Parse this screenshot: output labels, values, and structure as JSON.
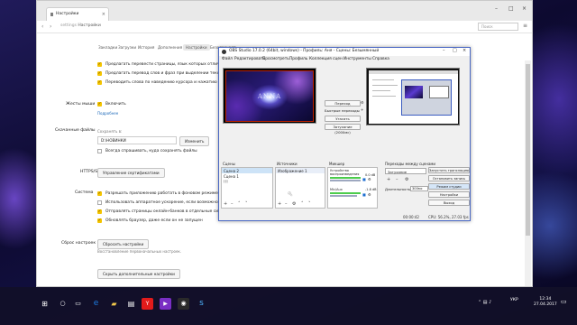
{
  "browser": {
    "tab_title": "Настройки",
    "url_prefix": "≡",
    "url_text": "settings",
    "url_title": "Настройки",
    "search_placeholder": "Поиск",
    "bookmarks": [
      "Закладки",
      "Загрузки",
      "История",
      "Дополнения",
      "Настройки",
      "Безопасность"
    ],
    "active_bookmark": 4
  },
  "settings": {
    "rows_top": [
      "Предлагать перевести страницы, язык которых отличается от языка интерфейса",
      "Предлагать перевод слов и фраз при выделении текста",
      "Переводить слова по наведению курсора и нажатию клавиши Shift"
    ],
    "gestures_section": "Жесты мыши",
    "gestures_enable": "Включить",
    "gestures_link": "Подробнее",
    "downloads_section": "Скачанные файлы",
    "save_to_label": "Сохранять в:",
    "save_path": "D:\\НОВИНКИ",
    "change_button": "Изменить",
    "always_ask": "Всегда спрашивать, куда сохранять файлы",
    "https_section": "HTTPS/SSL",
    "cert_button": "Управление сертификатами",
    "system_section": "Система",
    "system_rows": [
      "Разрешать приложению работать в фоновом режиме после закрытия браузера",
      "Использовать аппаратное ускорение, если возможно",
      "Отправлять страницы онлайн-банков в отдельные системы в дополнение к стандартным",
      "Обновлять браузер, даже если он не запущен"
    ],
    "reset_section": "Сброс настроек",
    "reset_button": "Сбросить настройки",
    "reset_hint": "Восстановление первоначальных настроек.",
    "hide_button": "Скрыть дополнительные настройки"
  },
  "obs": {
    "title": "OBS Studio 17.0.2 (64bit, windows) - Профиль: Аня - Сцены: Безымянный",
    "menu": [
      "Файл",
      "Редактировать",
      "Просмотреть",
      "Профиль",
      "Коллекция сцен",
      "Инструменты",
      "Справка"
    ],
    "preview_text": "ANNA",
    "transition_button": "Переход",
    "quick_transitions": "Быстрые переходы",
    "transition_select": "Угасать",
    "duration_select": "Затухание (2000мс)",
    "scenes_header": "Сцены",
    "scenes": [
      "Сцена 2",
      "Сцена 1",
      "!!!"
    ],
    "sources_header": "Источники",
    "sources": [
      "Изображение 1"
    ],
    "mixer_header": "Микшер",
    "mixer_device": "Устройство воспроизведения",
    "mixer_device_db": "0.0 dB",
    "mixer_mic": "Mic/Aux",
    "mixer_mic_db": "-1.8 dB",
    "transitions_header": "Переходы между сценами",
    "transitions_select": "Затухание",
    "duration_label": "Длительность",
    "duration_value": "300мс",
    "controls": [
      "Запустить трансляцию",
      "Остановить запись",
      "Режим студии",
      "Настройки",
      "Выход"
    ],
    "status": "00:00:42",
    "cpu": "CPU: 56.2%, 27.03 fps"
  },
  "watermark": {
    "title": "Активация Windows",
    "text": "Чтобы активировать Windows, перейдите в раздел \"Параметры\"."
  },
  "taskbar": {
    "lang": "УКР",
    "time": "12:34",
    "date": "27.04.2017"
  },
  "colors": {
    "checkbox": "#f4c400",
    "obs_border": "#4a68c4",
    "taskbar": "#12102a"
  }
}
